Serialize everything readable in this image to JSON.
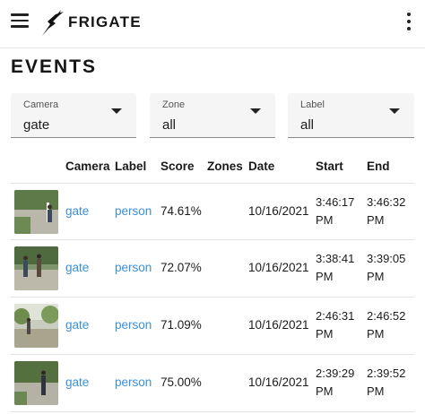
{
  "app": {
    "title": "FRIGATE"
  },
  "page": {
    "title": "EVENTS"
  },
  "filters": {
    "camera": {
      "label": "Camera",
      "value": "gate"
    },
    "zone": {
      "label": "Zone",
      "value": "all"
    },
    "label": {
      "label": "Label",
      "value": "all"
    }
  },
  "table": {
    "headers": {
      "camera": "Camera",
      "label": "Label",
      "score": "Score",
      "zones": "Zones",
      "date": "Date",
      "start": "Start",
      "end": "End"
    },
    "rows": [
      {
        "camera": "gate",
        "label": "person",
        "score": "74.61%",
        "zones": "",
        "date": "10/16/2021",
        "start_time": "3:46:17",
        "start_ampm": "PM",
        "end_time": "3:46:32",
        "end_ampm": "PM"
      },
      {
        "camera": "gate",
        "label": "person",
        "score": "72.07%",
        "zones": "",
        "date": "10/16/2021",
        "start_time": "3:38:41",
        "start_ampm": "PM",
        "end_time": "3:39:05",
        "end_ampm": "PM"
      },
      {
        "camera": "gate",
        "label": "person",
        "score": "71.09%",
        "zones": "",
        "date": "10/16/2021",
        "start_time": "2:46:31",
        "start_ampm": "PM",
        "end_time": "2:46:52",
        "end_ampm": "PM"
      },
      {
        "camera": "gate",
        "label": "person",
        "score": "75.00%",
        "zones": "",
        "date": "10/16/2021",
        "start_time": "2:39:29",
        "start_ampm": "PM",
        "end_time": "2:39:52",
        "end_ampm": "PM"
      }
    ]
  },
  "icons": {
    "menu": "hamburger-menu-icon",
    "logo": "frigate-bird-logo-icon",
    "more": "more-vertical-icon",
    "dropdown": "dropdown-arrow-icon"
  },
  "colors": {
    "link": "#3b8fd6",
    "select_bg": "#f5f5f5",
    "text": "#1c1c1c"
  }
}
